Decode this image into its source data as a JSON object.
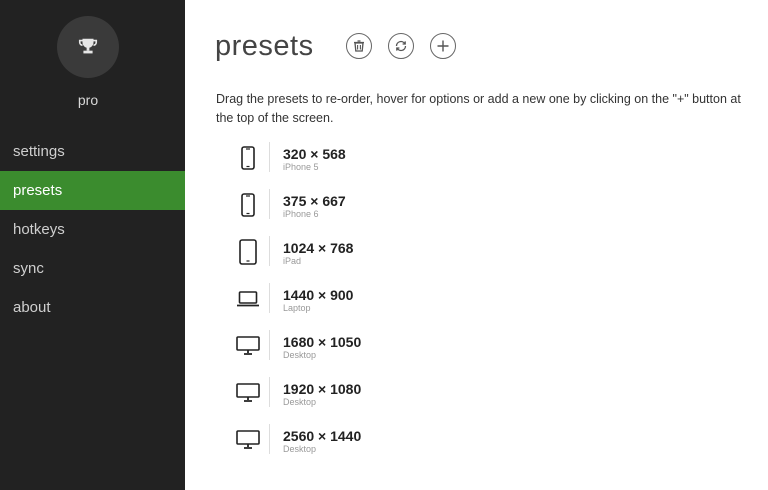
{
  "sidebar": {
    "plan_label": "pro",
    "nav": [
      {
        "label": "settings",
        "active": false
      },
      {
        "label": "presets",
        "active": true
      },
      {
        "label": "hotkeys",
        "active": false
      },
      {
        "label": "sync",
        "active": false
      },
      {
        "label": "about",
        "active": false
      }
    ]
  },
  "header": {
    "title": "presets",
    "actions": [
      "trash-icon",
      "refresh-icon",
      "add-icon"
    ]
  },
  "description": "Drag the presets to re-order, hover for options or add a new one by clicking on the \"+\" button at the top of the screen.",
  "presets": [
    {
      "size": "320 × 568",
      "name": "iPhone 5",
      "device": "phone"
    },
    {
      "size": "375 × 667",
      "name": "iPhone 6",
      "device": "phone"
    },
    {
      "size": "1024 × 768",
      "name": "iPad",
      "device": "tablet"
    },
    {
      "size": "1440 × 900",
      "name": "Laptop",
      "device": "laptop"
    },
    {
      "size": "1680 × 1050",
      "name": "Desktop",
      "device": "desktop"
    },
    {
      "size": "1920 × 1080",
      "name": "Desktop",
      "device": "desktop"
    },
    {
      "size": "2560 × 1440",
      "name": "Desktop",
      "device": "desktop"
    }
  ],
  "colors": {
    "sidebar_bg": "#222222",
    "active_nav": "#3b8c2e",
    "avatar_bg": "#3a3a3a"
  }
}
